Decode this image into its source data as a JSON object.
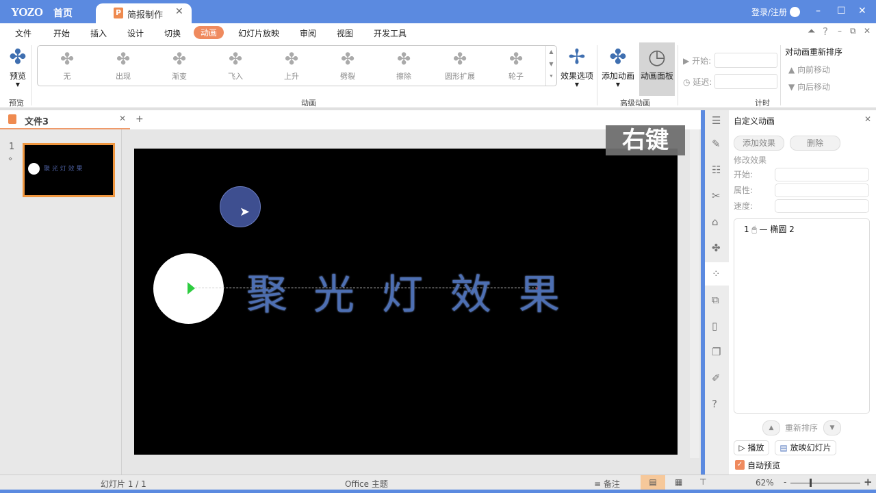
{
  "app": {
    "logo": "YOZO",
    "home": "首页",
    "doc_tab": "简报制作",
    "login": "登录/注册"
  },
  "menu": [
    "文件",
    "开始",
    "插入",
    "设计",
    "切换",
    "动画",
    "幻灯片放映",
    "审阅",
    "视图",
    "开发工具"
  ],
  "ribbon": {
    "preview": "预览",
    "preview_group": "预览",
    "gallery": [
      "无",
      "出现",
      "渐变",
      "飞入",
      "上升",
      "劈裂",
      "擦除",
      "圆形扩展",
      "轮子"
    ],
    "anim_group": "动画",
    "effect_options": "效果选项",
    "add_anim": "添加动画",
    "anim_pane": "动画面板",
    "adv_group": "高级动画",
    "start_label": "开始:",
    "delay_label": "延迟:",
    "timing_group": "计时",
    "reorder_title": "对动画重新排序",
    "move_earlier": "向前移动",
    "move_later": "向后移动"
  },
  "file_tab": {
    "name": "文件3",
    "add": "+"
  },
  "thumbs": [
    {
      "num": "1",
      "title": "聚 光 灯 效 果"
    }
  ],
  "slide": {
    "chars": [
      "聚",
      "光",
      "灯",
      "效",
      "果"
    ]
  },
  "overlay": "右键",
  "panel": {
    "title": "自定义动画",
    "add_effect": "添加效果",
    "delete": "删除",
    "modify": "修改效果",
    "start": "开始:",
    "property": "属性:",
    "speed": "速度:",
    "items": [
      {
        "num": "1",
        "name": "椭圆 2"
      }
    ],
    "reorder": "重新排序",
    "play": "播放",
    "slideshow": "放映幻灯片",
    "auto_preview": "自动预览",
    "auto_preview_checked": true
  },
  "status": {
    "slide": "幻灯片 1 / 1",
    "theme": "Office 主题",
    "notes": "备注",
    "zoom": "62%",
    "zoom_level": 62
  },
  "colors": {
    "accent": "#ef8a5e",
    "titlebar": "#5b8ae0",
    "icon_blue": "#3f6fb0"
  }
}
